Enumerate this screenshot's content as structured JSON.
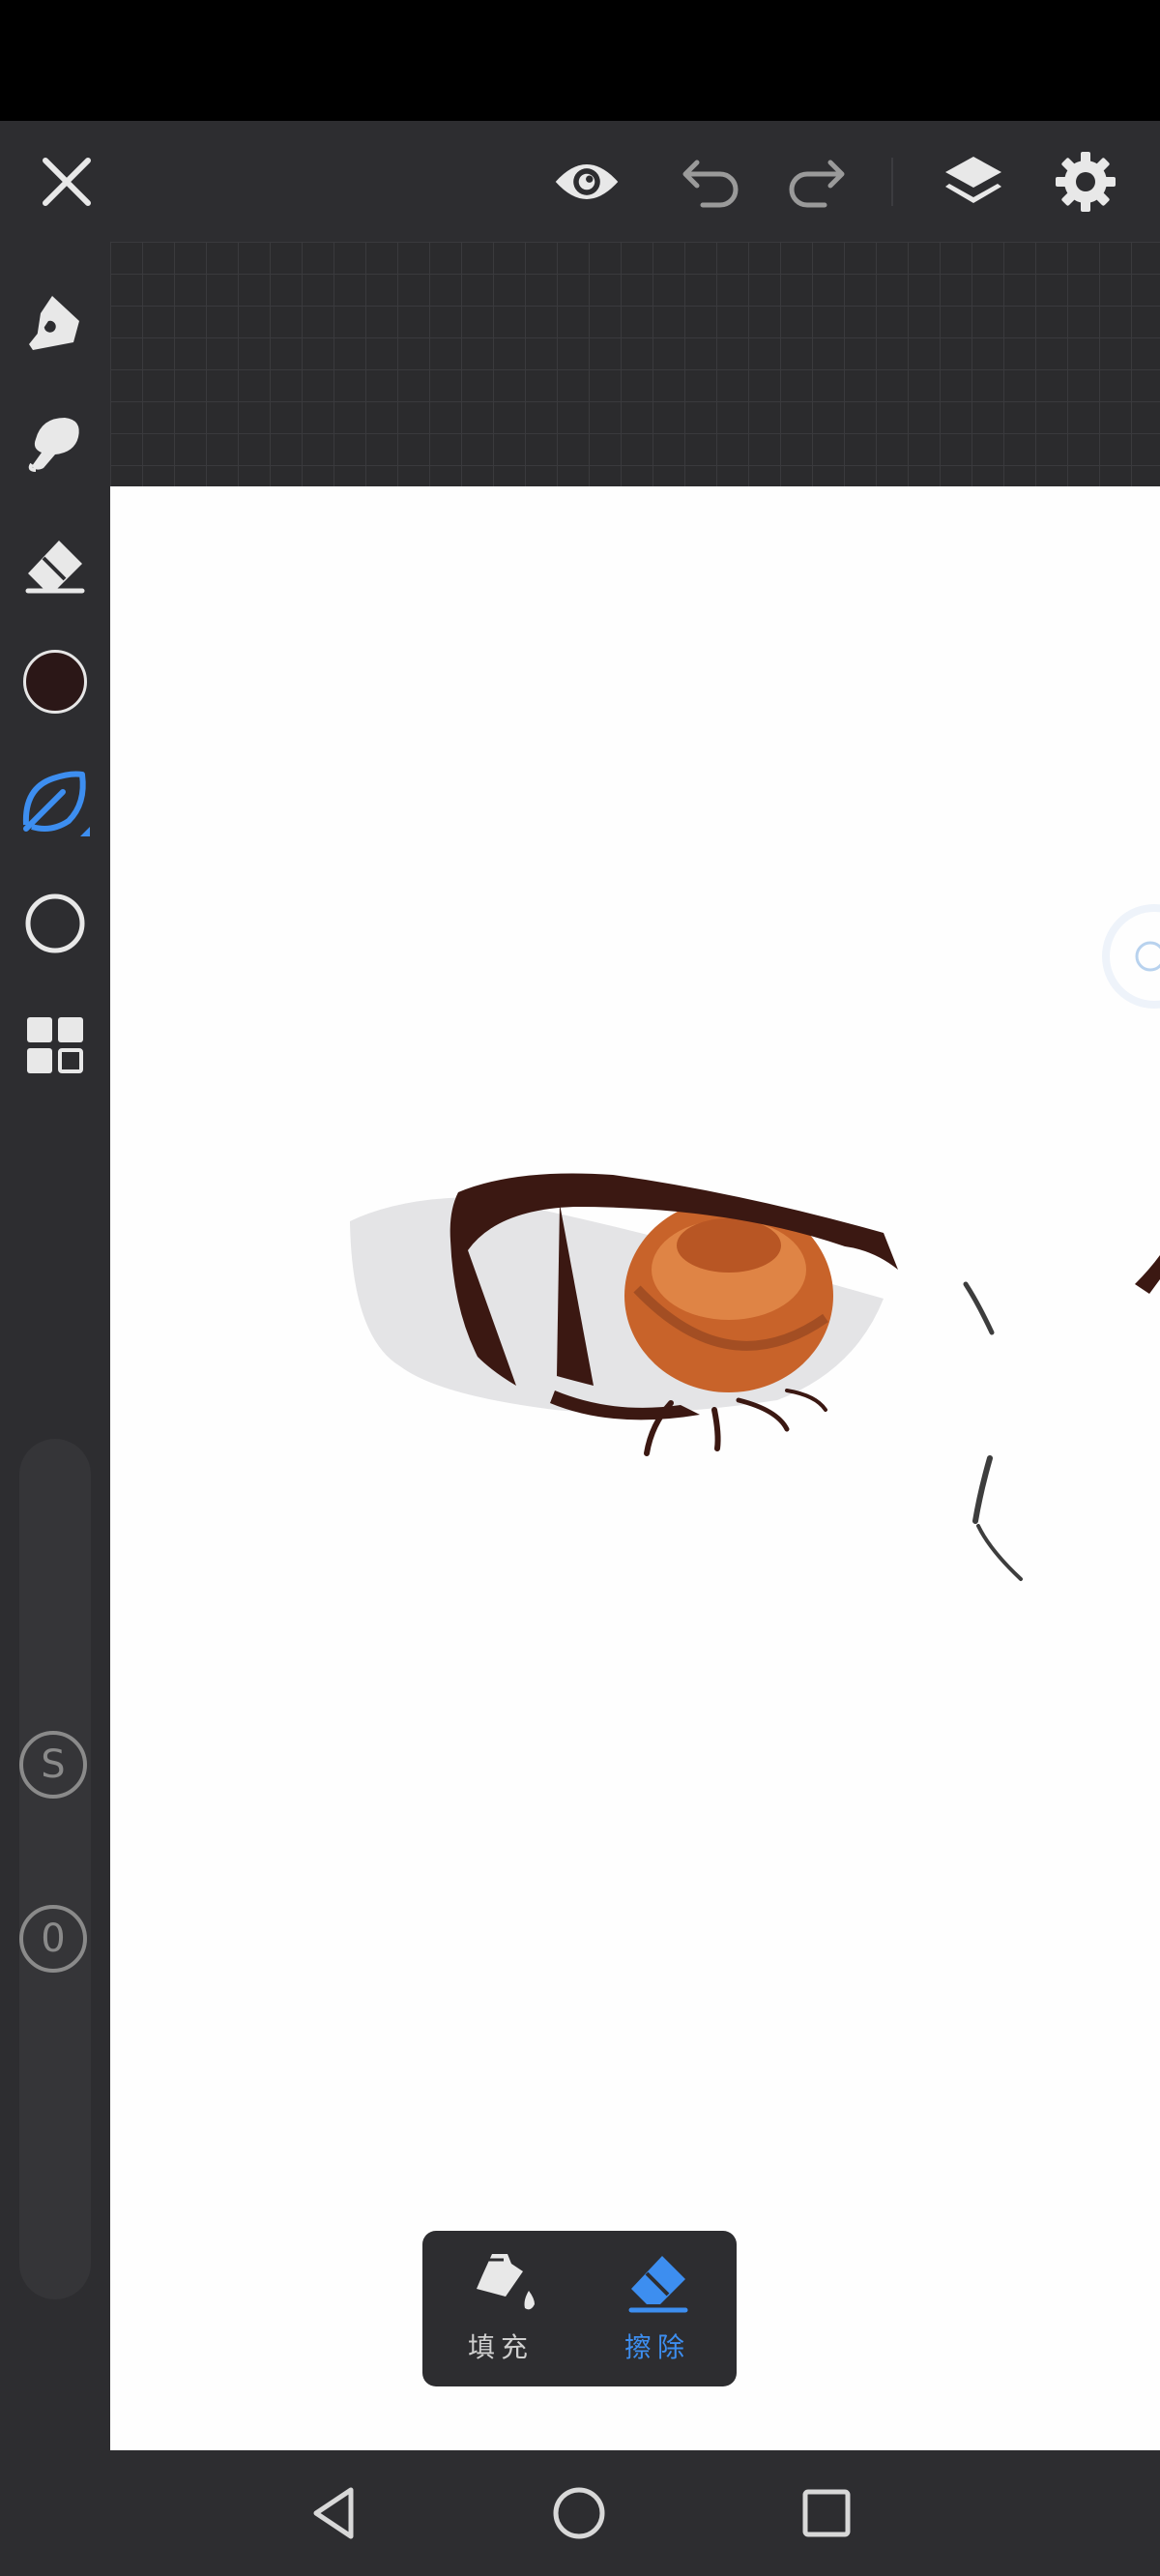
{
  "app": {
    "name": "drawing-app",
    "accent_color": "#3d8ef0",
    "current_brush_color": "#2b1717"
  },
  "top_toolbar": {
    "icons": [
      "close-icon",
      "eye-icon",
      "undo-icon",
      "redo-icon",
      "layers-icon",
      "gear-icon"
    ]
  },
  "left_toolbar": {
    "tools": [
      "pen-tool-icon",
      "smudge-tool-icon",
      "eraser-icon",
      "color-swatch",
      "brush-leaf-icon",
      "shape-circle-icon",
      "grid-menu-icon"
    ],
    "active_tool": "brush-leaf-icon",
    "size_label": "S",
    "opacity_label": "0"
  },
  "fill_erase_popup": {
    "fill_label": "填充",
    "erase_label": "擦除",
    "active": "erase"
  },
  "nav_bar": {
    "icons": [
      "back-icon",
      "home-icon",
      "recents-icon"
    ]
  }
}
